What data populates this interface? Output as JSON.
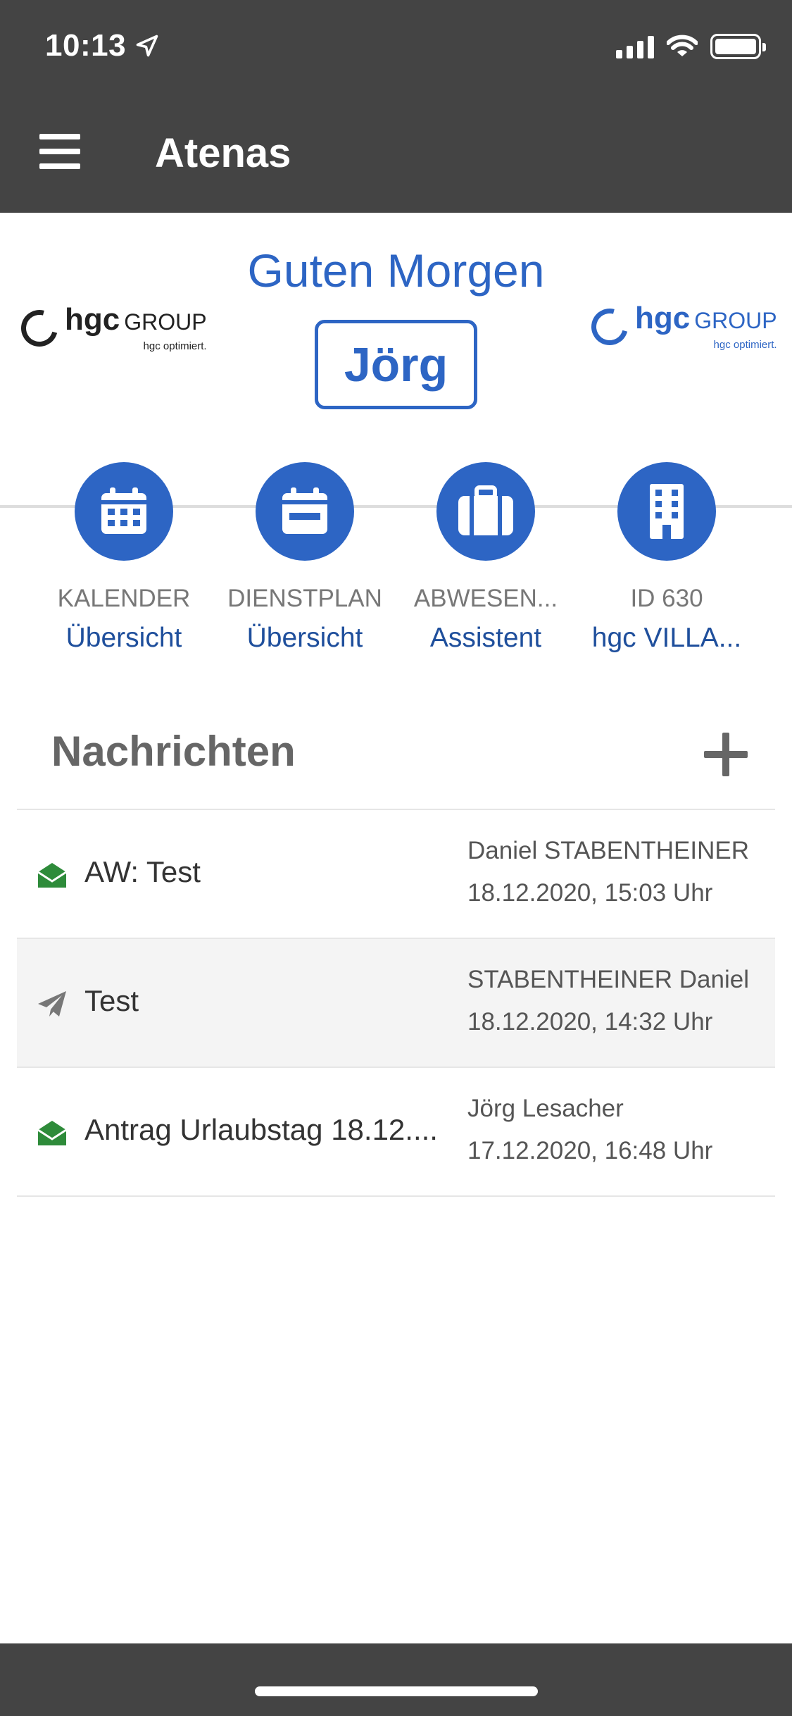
{
  "status_bar": {
    "time": "10:13"
  },
  "app_bar": {
    "title": "Atenas"
  },
  "greeting": {
    "text": "Guten Morgen",
    "name": "Jörg"
  },
  "logos": {
    "left": {
      "brand": "hgc",
      "group": "GROUP",
      "tagline": "hgc optimiert."
    },
    "right": {
      "brand": "hgc",
      "group": "GROUP",
      "tagline": "hgc optimiert."
    }
  },
  "quick_actions": [
    {
      "icon": "calendar-grid-icon",
      "label": "KALENDER",
      "link": "Übersicht"
    },
    {
      "icon": "calendar-schedule-icon",
      "label": "DIENSTPLAN",
      "link": "Übersicht"
    },
    {
      "icon": "suitcase-icon",
      "label": "ABWESEN...",
      "link": "Assistent"
    },
    {
      "icon": "building-icon",
      "label": "ID 630",
      "link": "hgc VILLA..."
    }
  ],
  "messages": {
    "title": "Nachrichten",
    "items": [
      {
        "icon": "envelope-open-icon",
        "subject": "AW: Test",
        "sender": "Daniel STABENTHEINER",
        "date": "18.12.2020, 15:03 Uhr"
      },
      {
        "icon": "paper-plane-icon",
        "subject": "Test",
        "sender": "STABENTHEINER Daniel",
        "date": "18.12.2020, 14:32 Uhr"
      },
      {
        "icon": "envelope-open-icon",
        "subject": "Antrag Urlaubstag 18.12....",
        "sender": "Jörg Lesacher",
        "date": "17.12.2020, 16:48 Uhr"
      }
    ]
  },
  "colors": {
    "bar": "#444444",
    "accent": "#2d65c4",
    "read_icon": "#2e8b3a",
    "sent_icon": "#777777"
  }
}
